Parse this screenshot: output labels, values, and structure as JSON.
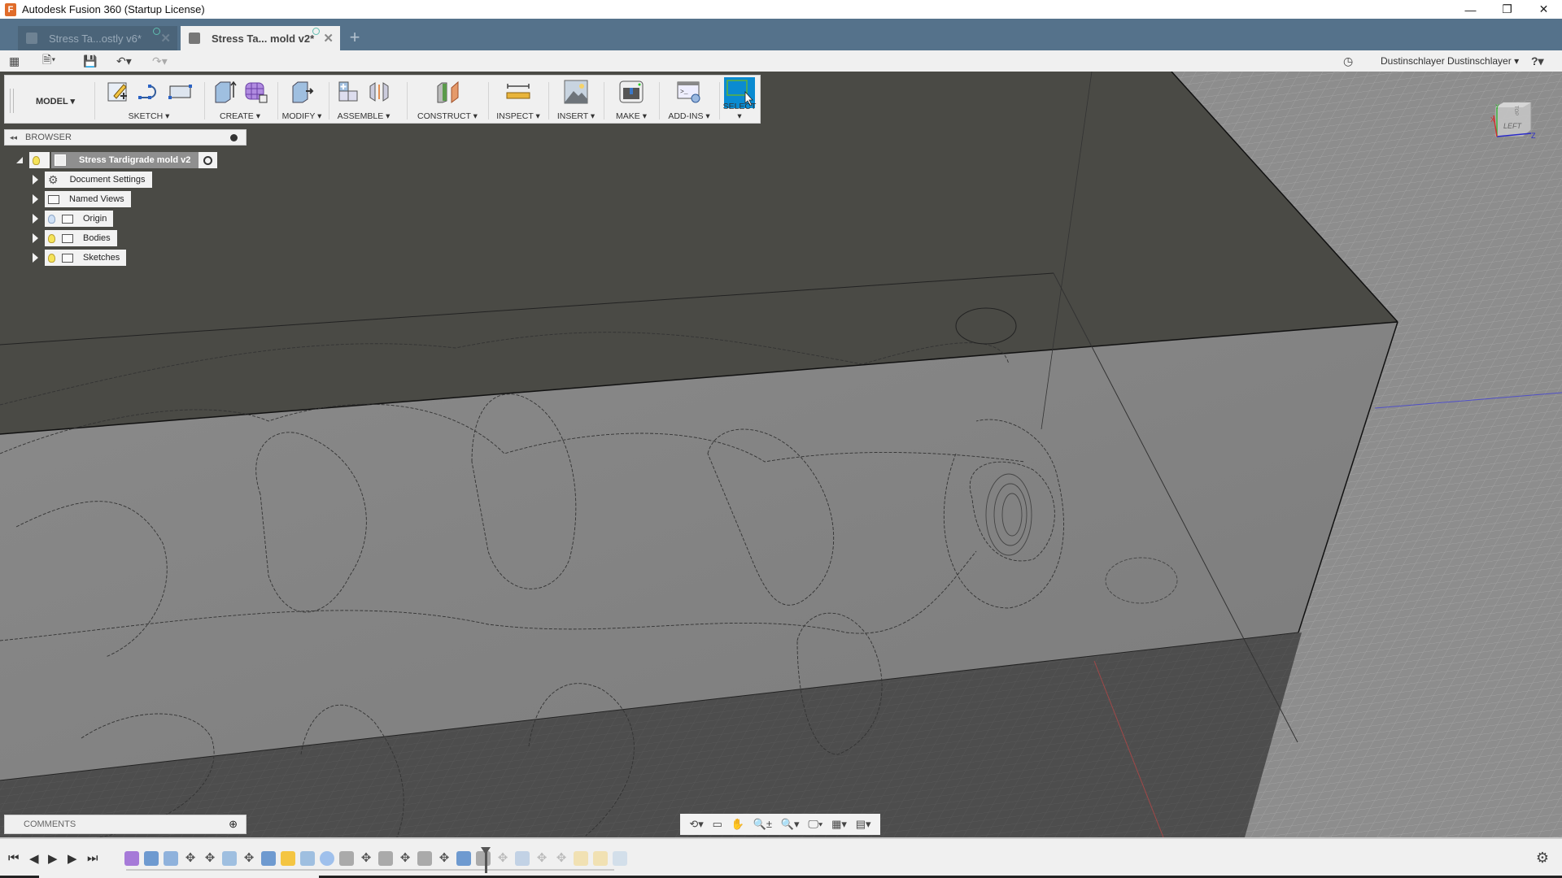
{
  "window": {
    "title": "Autodesk Fusion 360 (Startup License)",
    "app_icon": "F",
    "controls": {
      "minimize": "—",
      "restore": "❐",
      "close": "✕"
    }
  },
  "tabs": [
    {
      "label": "Stress Ta...ostly v6*",
      "active": false,
      "close": "✕"
    },
    {
      "label": "Stress Ta... mold v2*",
      "active": true,
      "close": "✕"
    }
  ],
  "new_tab_label": "+",
  "quick_access": {
    "grid_icon": "▦",
    "file_icon": "🗎▾",
    "save_icon": "💾",
    "undo_icon": "↶▾",
    "redo_icon": "↷▾",
    "history_icon": "◷",
    "user": "Dustinschlayer Dustinschlayer ▾",
    "help": "?▾"
  },
  "toolbar": {
    "workspace": "MODEL ▾",
    "groups": [
      {
        "label": "SKETCH ▾",
        "icons": [
          "create-sketch",
          "arc",
          "rectangle"
        ]
      },
      {
        "label": "CREATE ▾",
        "icons": [
          "extrude",
          "create-form"
        ]
      },
      {
        "label": "MODIFY ▾",
        "icons": [
          "press-pull"
        ]
      },
      {
        "label": "ASSEMBLE ▾",
        "icons": [
          "new-component",
          "joint"
        ]
      },
      {
        "label": "CONSTRUCT ▾",
        "icons": [
          "offset-plane"
        ]
      },
      {
        "label": "INSPECT ▾",
        "icons": [
          "measure"
        ]
      },
      {
        "label": "INSERT ▾",
        "icons": [
          "insert-image"
        ]
      },
      {
        "label": "MAKE ▾",
        "icons": [
          "3d-print"
        ]
      },
      {
        "label": "ADD-INS ▾",
        "icons": [
          "scripts"
        ]
      },
      {
        "label": "SELECT ▾",
        "icons": [
          "select"
        ]
      }
    ]
  },
  "browser": {
    "header": "BROWSER",
    "collapse_icon": "◂◂",
    "root": "Stress Tardigrade mold v2",
    "items": [
      {
        "label": "Document Settings",
        "icon": "gear",
        "bulb": null
      },
      {
        "label": "Named Views",
        "icon": "folder",
        "bulb": null
      },
      {
        "label": "Origin",
        "icon": "folder",
        "bulb": "off"
      },
      {
        "label": "Bodies",
        "icon": "folder",
        "bulb": "on"
      },
      {
        "label": "Sketches",
        "icon": "folder",
        "bulb": "on"
      }
    ]
  },
  "comments": {
    "label": "COMMENTS",
    "add_icon": "⊕"
  },
  "navbar": [
    "⟲▾",
    "▭",
    "✋",
    "🔍±",
    "🔍▾",
    "🖵▾",
    "▦▾",
    "▤▾"
  ],
  "viewcube": {
    "face": "LEFT",
    "top": "TOP",
    "axes": [
      "X",
      "Y",
      "Z"
    ]
  },
  "timeline": {
    "controls": [
      "⏮",
      "◀",
      "▶",
      "▶",
      "⏭"
    ],
    "settings_icon": "⚙"
  },
  "colors": {
    "tabbar": "#55728b",
    "select_active": "#0a8bd1",
    "body_top": "#4a4a46",
    "body_front": "#8c8c8c",
    "grid_bg": "#8f8f8f"
  }
}
